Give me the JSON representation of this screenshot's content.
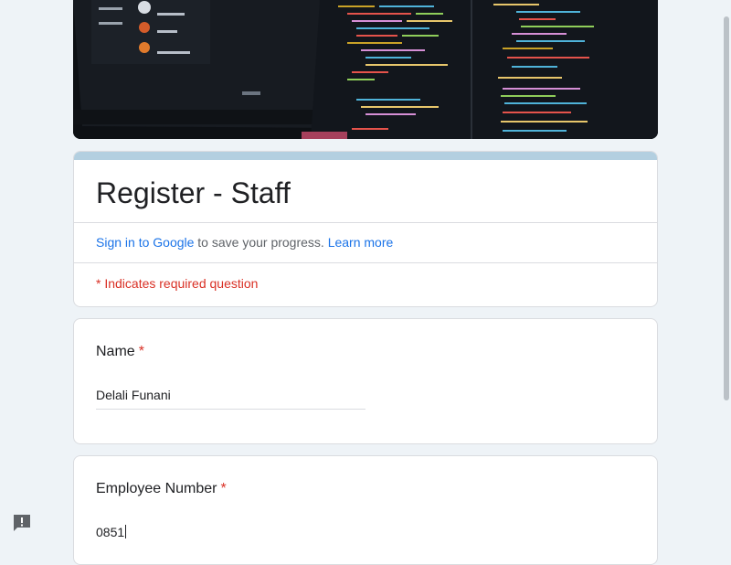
{
  "form": {
    "title": "Register - Staff",
    "signin_link": "Sign in to Google",
    "signin_text": " to save your progress. ",
    "learn_more": "Learn more",
    "required_note": "* Indicates required question"
  },
  "questions": [
    {
      "label": "Name",
      "required_marker": "*",
      "value": "Delali Funani"
    },
    {
      "label": "Employee Number",
      "required_marker": "*",
      "value": "0851"
    }
  ],
  "colors": {
    "accent": "#b3cfe0",
    "link": "#1a73e8",
    "required": "#d93025",
    "background": "#eef3f7"
  },
  "icons": {
    "report": "report-problem-icon"
  }
}
